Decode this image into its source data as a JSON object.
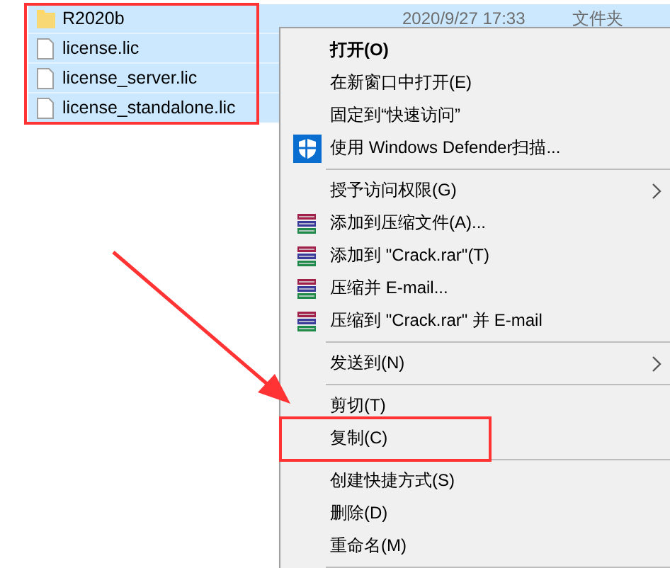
{
  "files": [
    {
      "name": "R2020b",
      "kind": "folder",
      "date": "2020/9/27 17:33",
      "type": "文件夹",
      "selected": true
    },
    {
      "name": "license.lic",
      "kind": "file",
      "selected": true
    },
    {
      "name": "license_server.lic",
      "kind": "file",
      "selected": true
    },
    {
      "name": "license_standalone.lic",
      "kind": "file",
      "selected": true
    }
  ],
  "context_menu": [
    {
      "kind": "item",
      "label": "打开(O)",
      "bold": true
    },
    {
      "kind": "item",
      "label": "在新窗口中打开(E)"
    },
    {
      "kind": "item",
      "label": "固定到“快速访问”"
    },
    {
      "kind": "scan",
      "label": "使用 Windows Defender扫描..."
    },
    {
      "kind": "separator"
    },
    {
      "kind": "item",
      "label": "授予访问权限(G)",
      "submenu": true
    },
    {
      "kind": "archive",
      "label": "添加到压缩文件(A)..."
    },
    {
      "kind": "archive",
      "label": "添加到 \"Crack.rar\"(T)"
    },
    {
      "kind": "archive",
      "label": "压缩并 E-mail..."
    },
    {
      "kind": "archive",
      "label": "压缩到 \"Crack.rar\" 并 E-mail"
    },
    {
      "kind": "separator"
    },
    {
      "kind": "item",
      "label": "发送到(N)",
      "submenu": true
    },
    {
      "kind": "separator"
    },
    {
      "kind": "item",
      "label": "剪切(T)"
    },
    {
      "kind": "item",
      "label": "复制(C)",
      "marked": true
    },
    {
      "kind": "separator"
    },
    {
      "kind": "item",
      "label": "创建快捷方式(S)"
    },
    {
      "kind": "item",
      "label": "删除(D)"
    },
    {
      "kind": "item",
      "label": "重命名(M)"
    },
    {
      "kind": "separator"
    }
  ]
}
